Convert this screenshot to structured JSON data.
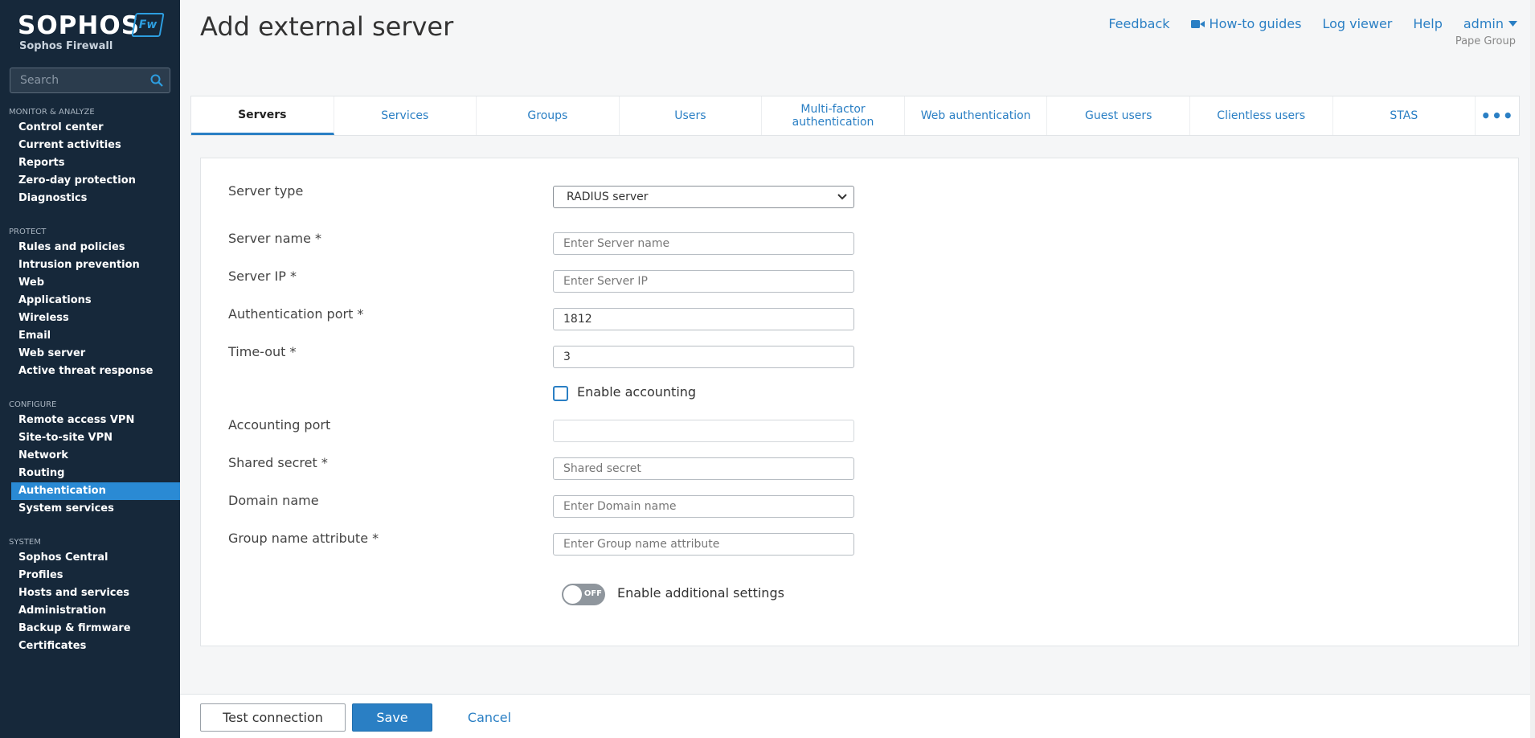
{
  "brand": {
    "name": "SOPHOS",
    "product": "Sophos Firewall",
    "badge": "Fw"
  },
  "search": {
    "placeholder": "Search"
  },
  "nav": {
    "monitor": {
      "heading": "MONITOR & ANALYZE",
      "items": [
        "Control center",
        "Current activities",
        "Reports",
        "Zero-day protection",
        "Diagnostics"
      ]
    },
    "protect": {
      "heading": "PROTECT",
      "items": [
        "Rules and policies",
        "Intrusion prevention",
        "Web",
        "Applications",
        "Wireless",
        "Email",
        "Web server",
        "Active threat response"
      ]
    },
    "configure": {
      "heading": "CONFIGURE",
      "items": [
        "Remote access VPN",
        "Site-to-site VPN",
        "Network",
        "Routing",
        "Authentication",
        "System services"
      ]
    },
    "system": {
      "heading": "SYSTEM",
      "items": [
        "Sophos Central",
        "Profiles",
        "Hosts and services",
        "Administration",
        "Backup & firmware",
        "Certificates"
      ]
    },
    "active_item": "Authentication"
  },
  "header": {
    "title": "Add external server",
    "links": {
      "feedback": "Feedback",
      "howto": "How-to guides",
      "logviewer": "Log viewer",
      "help": "Help",
      "user": "admin"
    },
    "org": "Pape Group"
  },
  "tabs": [
    "Servers",
    "Services",
    "Groups",
    "Users",
    "Multi-factor authentication",
    "Web authentication",
    "Guest users",
    "Clientless users",
    "STAS"
  ],
  "active_tab": "Servers",
  "more_tabs": "•••",
  "form": {
    "server_type": {
      "label": "Server type",
      "value": "RADIUS server"
    },
    "server_name": {
      "label": "Server name *",
      "placeholder": "Enter Server name",
      "value": ""
    },
    "server_ip": {
      "label": "Server IP *",
      "placeholder": "Enter Server IP",
      "value": ""
    },
    "auth_port": {
      "label": "Authentication port *",
      "value": "1812"
    },
    "timeout": {
      "label": "Time-out *",
      "value": "3"
    },
    "enable_accounting": {
      "label": "Enable accounting",
      "checked": false
    },
    "accounting_port": {
      "label": "Accounting port",
      "value": ""
    },
    "shared_secret": {
      "label": "Shared secret *",
      "placeholder": "Shared secret",
      "value": ""
    },
    "domain_name": {
      "label": "Domain name",
      "placeholder": "Enter Domain name",
      "value": ""
    },
    "group_name_attr": {
      "label": "Group name attribute *",
      "placeholder": "Enter Group name attribute",
      "value": ""
    },
    "additional_settings": {
      "label": "Enable additional settings",
      "state": "OFF"
    }
  },
  "footer": {
    "test": "Test connection",
    "save": "Save",
    "cancel": "Cancel"
  },
  "colors": {
    "sidebar": "#16283a",
    "accent": "#2a7fc4",
    "active_nav": "#2a8ad4"
  }
}
